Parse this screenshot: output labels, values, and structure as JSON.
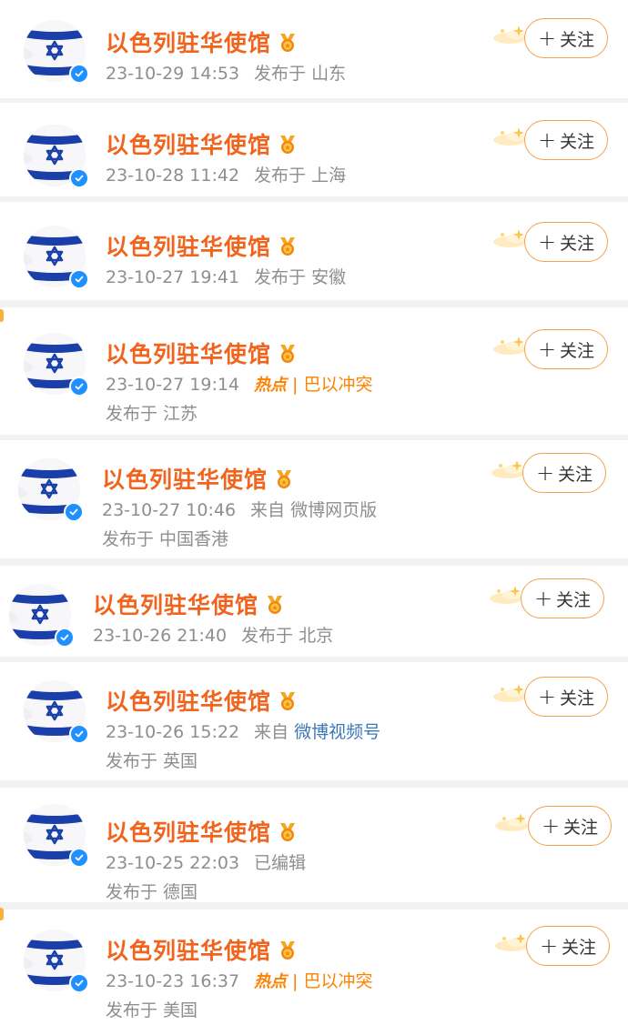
{
  "colors": {
    "username": "#f0641e",
    "meta": "#8e8e8e",
    "hot": "#ff8200",
    "link": "#3b78b8",
    "follow_border": "#f4a14a",
    "verified": "#1e90ff",
    "flag_blue": "#1a3fa8"
  },
  "icons": {
    "medal": "medal-icon",
    "verified": "verified-badge-icon",
    "follow": "plus-icon",
    "deco": "sparkle-decoration-icon"
  },
  "follow_label": "关注",
  "follow_plus": "+",
  "posts": [
    {
      "name": "以色列驻华使馆",
      "time": "23-10-29 14:53",
      "line1_rest": "发布于 山东",
      "line2": ""
    },
    {
      "name": "以色列驻华使馆",
      "time": "23-10-28 11:42",
      "line1_rest": "发布于 上海",
      "line2": ""
    },
    {
      "name": "以色列驻华使馆",
      "time": "23-10-27 19:41",
      "line1_rest": "发布于 安徽",
      "line2": ""
    },
    {
      "name": "以色列驻华使馆",
      "time": "23-10-27 19:14",
      "hot": "热点",
      "sep": "|",
      "topic": "巴以冲突",
      "line2": "发布于 江苏"
    },
    {
      "name": "以色列驻华使馆",
      "time": "23-10-27 10:46",
      "source_prefix": "来自",
      "source": "微博网页版",
      "line2": "发布于 中国香港"
    },
    {
      "name": "以色列驻华使馆",
      "time": "23-10-26 21:40",
      "line1_rest": "发布于 北京",
      "line2": ""
    },
    {
      "name": "以色列驻华使馆",
      "time": "23-10-26 15:22",
      "source_prefix": "来自",
      "source_link": "微博视频号",
      "line2": "发布于 英国"
    },
    {
      "name": "以色列驻华使馆",
      "time": "23-10-25 22:03",
      "line1_rest": "已编辑",
      "line2": "发布于 德国"
    },
    {
      "name": "以色列驻华使馆",
      "time": "23-10-23 16:37",
      "hot": "热点",
      "sep": "|",
      "topic": "巴以冲突",
      "line2": "发布于 美国"
    }
  ]
}
